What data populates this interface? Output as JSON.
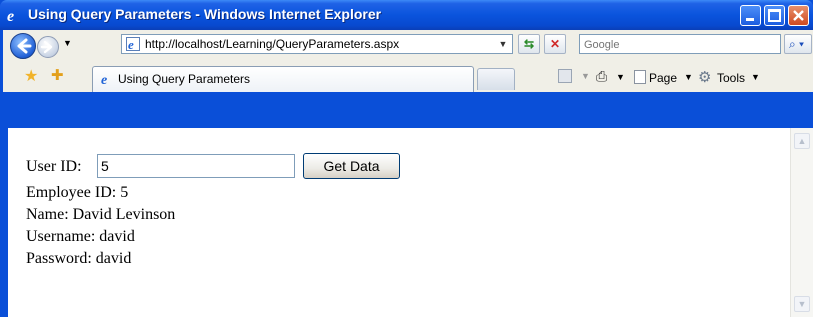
{
  "window": {
    "title": "Using Query Parameters - Windows Internet Explorer"
  },
  "address_bar": {
    "url": "http://localhost/Learning/QueryParameters.aspx",
    "search_placeholder": "Google"
  },
  "tabs": [
    {
      "label": "Using Query Parameters",
      "active": true
    }
  ],
  "command_bar": {
    "page_label": "Page",
    "tools_label": "Tools"
  },
  "form": {
    "userid_label": "User ID:",
    "userid_value": "5",
    "submit_label": "Get Data"
  },
  "results": {
    "employee_id": "Employee ID: 5",
    "name": "Name: David Levinson",
    "username": "Username: david",
    "password": "Password: david"
  },
  "colors": {
    "titlebar": "#0a54dd",
    "chrome": "#f0efe7",
    "page_background": "#ffffff"
  }
}
